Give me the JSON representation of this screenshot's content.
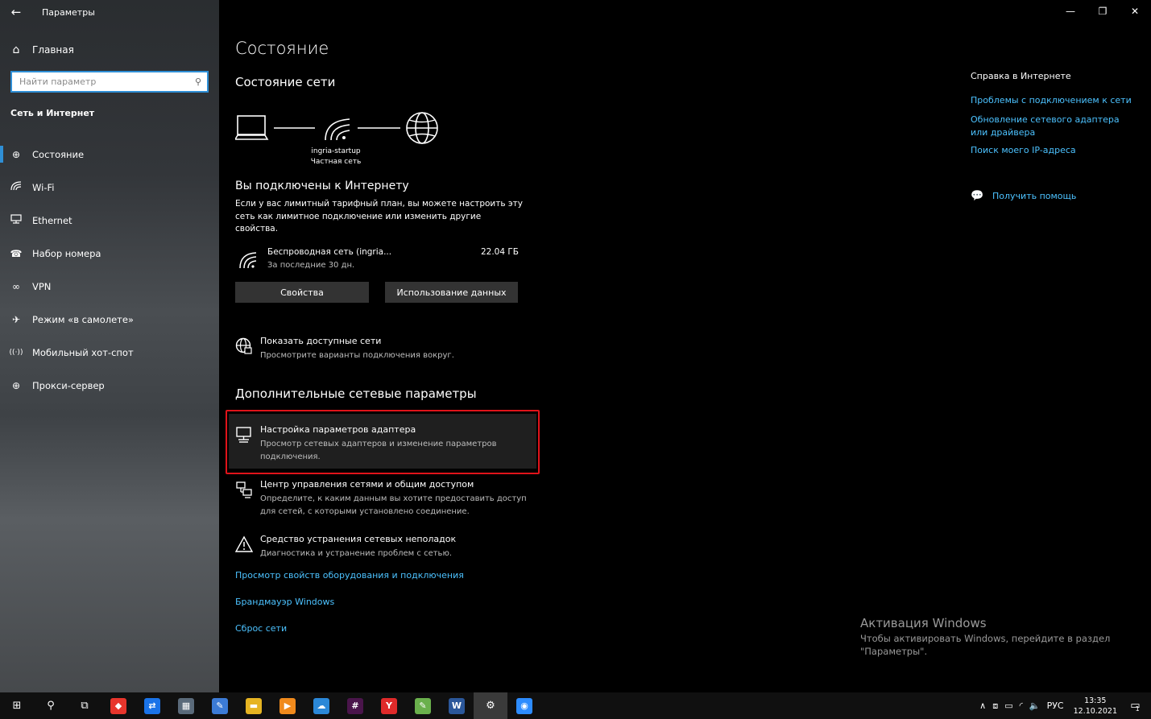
{
  "window": {
    "title": "Параметры",
    "back_icon": "←",
    "minimize": "—",
    "maximize": "❐",
    "close": "✕"
  },
  "sidebar": {
    "home": "Главная",
    "search_placeholder": "Найти параметр",
    "section": "Сеть и Интернет",
    "items": [
      {
        "label": "Состояние",
        "icon": "⊕",
        "icon_name": "status-globe-icon"
      },
      {
        "label": "Wi-Fi",
        "icon": "◜",
        "icon_name": "wifi-icon"
      },
      {
        "label": "Ethernet",
        "icon": "▭",
        "icon_name": "ethernet-icon"
      },
      {
        "label": "Набор номера",
        "icon": "☎",
        "icon_name": "dialup-icon"
      },
      {
        "label": "VPN",
        "icon": "∞",
        "icon_name": "vpn-icon"
      },
      {
        "label": "Режим «в самолете»",
        "icon": "✈",
        "icon_name": "airplane-icon"
      },
      {
        "label": "Мобильный хот-спот",
        "icon": "((·))",
        "icon_name": "hotspot-icon"
      },
      {
        "label": "Прокси-сервер",
        "icon": "⊕",
        "icon_name": "proxy-globe-icon"
      }
    ]
  },
  "main": {
    "title": "Состояние",
    "subtitle": "Состояние сети",
    "network_name": "ingria-startup",
    "network_type": "Частная сеть",
    "connected_title": "Вы подключены к Интернету",
    "connected_desc": "Если у вас лимитный тарифный план, вы можете настроить эту сеть как лимитное подключение или изменить другие свойства.",
    "adapter_name": "Беспроводная сеть (ingria...",
    "adapter_sub": "За последние 30 дн.",
    "adapter_usage": "22.04 ГБ",
    "btn_properties": "Свойства",
    "btn_usage": "Использование данных",
    "show_networks_title": "Показать доступные сети",
    "show_networks_desc": "Просмотрите варианты подключения вокруг.",
    "advanced_title": "Дополнительные сетевые параметры",
    "adapter_settings_title": "Настройка параметров адаптера",
    "adapter_settings_desc": "Просмотр сетевых адаптеров и изменение параметров подключения.",
    "center_title": "Центр управления сетями и общим доступом",
    "center_desc": "Определите, к каким данным вы хотите предоставить доступ для сетей, с которыми установлено соединение.",
    "troubleshoot_title": "Средство устранения сетевых неполадок",
    "troubleshoot_desc": "Диагностика и устранение проблем с сетью.",
    "link_hardware": "Просмотр свойств оборудования и подключения",
    "link_firewall": "Брандмауэр Windows",
    "link_reset": "Сброс сети"
  },
  "right": {
    "help_title": "Справка в Интернете",
    "links": [
      "Проблемы с подключением к сети",
      "Обновление сетевого адаптера или драйвера",
      "Поиск моего IP-адреса"
    ],
    "get_help": "Получить помощь"
  },
  "activation": {
    "title": "Активация Windows",
    "desc": "Чтобы активировать Windows, перейдите в раздел \"Параметры\"."
  },
  "taskbar": {
    "apps": [
      {
        "name": "windows-start-icon",
        "glyph": "⊞",
        "color": "",
        "interactable": true
      },
      {
        "name": "search-icon",
        "glyph": "⚲",
        "color": ""
      },
      {
        "name": "task-view-icon",
        "glyph": "⧉",
        "color": ""
      },
      {
        "name": "anydesk-icon",
        "glyph": "◆",
        "color": "#e8352c"
      },
      {
        "name": "teamviewer-icon",
        "glyph": "⇄",
        "color": "#1a73e8"
      },
      {
        "name": "calculator-icon",
        "glyph": "▦",
        "color": "#5a6a7a"
      },
      {
        "name": "paint-icon",
        "glyph": "✎",
        "color": "#3c7bd6"
      },
      {
        "name": "file-explorer-icon",
        "glyph": "▬",
        "color": "#e6b422"
      },
      {
        "name": "media-player-icon",
        "glyph": "▶",
        "color": "#f08a1c"
      },
      {
        "name": "onedrive-icon",
        "glyph": "☁",
        "color": "#2b88d8"
      },
      {
        "name": "slack-icon",
        "glyph": "#",
        "color": "#4a154b"
      },
      {
        "name": "yandex-browser-icon",
        "glyph": "Y",
        "color": "#e02a2a"
      },
      {
        "name": "notepad-plus-icon",
        "glyph": "✎",
        "color": "#6ab04c"
      },
      {
        "name": "word-icon",
        "glyph": "W",
        "color": "#2b579a"
      },
      {
        "name": "settings-gear-icon",
        "glyph": "⚙",
        "color": "",
        "active": true
      },
      {
        "name": "zoom-icon",
        "glyph": "◉",
        "color": "#2d8cff"
      }
    ],
    "tray_up": "∧",
    "language": "РУС",
    "time": "13:35",
    "date": "12.10.2021",
    "notifications": "▭",
    "notification_count": "1"
  }
}
